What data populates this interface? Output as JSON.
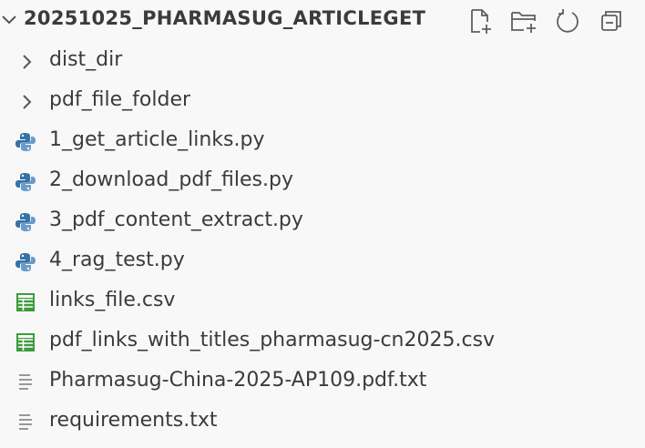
{
  "explorer": {
    "title": "20251025_PHARMASUG_ARTICLEGET",
    "actions": [
      {
        "name": "new-file-icon"
      },
      {
        "name": "new-folder-icon"
      },
      {
        "name": "refresh-icon"
      },
      {
        "name": "collapse-all-icon"
      }
    ],
    "items": [
      {
        "label": "dist_dir",
        "type": "folder",
        "icon": "chevron-right-icon"
      },
      {
        "label": "pdf_file_folder",
        "type": "folder",
        "icon": "chevron-right-icon"
      },
      {
        "label": "1_get_article_links.py",
        "type": "python",
        "icon": "python-icon"
      },
      {
        "label": "2_download_pdf_files.py",
        "type": "python",
        "icon": "python-icon"
      },
      {
        "label": "3_pdf_content_extract.py",
        "type": "python",
        "icon": "python-icon"
      },
      {
        "label": "4_rag_test.py",
        "type": "python",
        "icon": "python-icon"
      },
      {
        "label": "links_file.csv",
        "type": "csv",
        "icon": "csv-icon"
      },
      {
        "label": "pdf_links_with_titles_pharmasug-cn2025.csv",
        "type": "csv",
        "icon": "csv-icon"
      },
      {
        "label": "Pharmasug-China-2025-AP109.pdf.txt",
        "type": "text",
        "icon": "text-file-icon"
      },
      {
        "label": "requirements.txt",
        "type": "text",
        "icon": "text-file-icon"
      }
    ]
  },
  "colors": {
    "python_blue": "#3572a5",
    "python_light": "#6b9bc9",
    "csv_green": "#3d9a3d",
    "text_gray": "#8a8a8a",
    "icon_gray": "#5f5f5f"
  }
}
